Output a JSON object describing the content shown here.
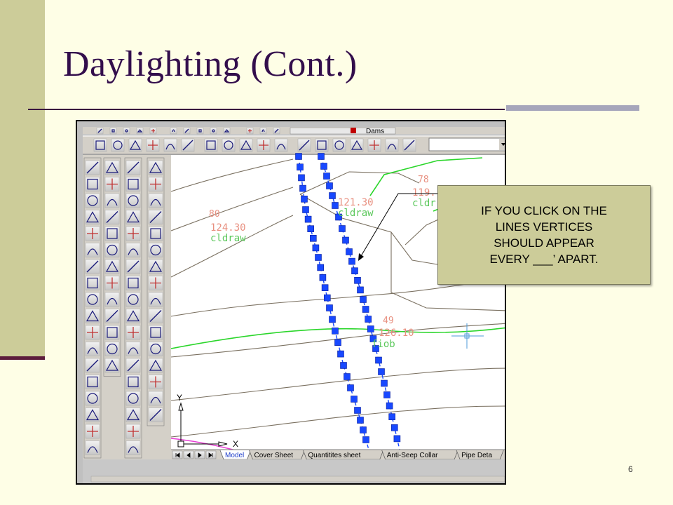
{
  "slide": {
    "title": "Daylighting (Cont.)",
    "page_number": "6",
    "callout": "IF YOU CLICK ON THE\nLINES VERTICES\nSHOULD APPEAR\nEVERY ___’ APART."
  },
  "cad": {
    "layer_name": "Dams",
    "layout_tabs": [
      "Model",
      "Cover Sheet",
      "Quantitites sheet",
      "Anti-Seep Collar",
      "Pipe Deta"
    ],
    "active_tab": "Model",
    "tab_nav": [
      "first-tab",
      "prev-tab",
      "next-tab",
      "last-tab"
    ],
    "ucs": {
      "x_label": "X",
      "y_label": "Y"
    },
    "elevation_labels": [
      {
        "top": "80",
        "value": "124.30",
        "code": "cldraw"
      },
      {
        "top": "",
        "value": "121.30",
        "code": "cldraw"
      },
      {
        "top": "78",
        "value": "119.",
        "code": "cldr"
      },
      {
        "top": "49",
        "value": "126.10",
        "code": "fiob"
      }
    ],
    "colors": {
      "canvas": "#ffffff",
      "contour": "#7a7060",
      "ground_line": "#2bd62b",
      "property_line": "#e63cd4",
      "vertex_grip": "#1848ff",
      "label_text": "#e89080",
      "label_code": "#5cc85c",
      "crosshair": "#4e9ad8"
    },
    "toolbars": {
      "standard": [
        "new-icon",
        "open-icon",
        "save-icon",
        "print-icon",
        "preview-icon",
        "cut-icon",
        "copy-icon",
        "paste-icon",
        "match-icon",
        "undo-icon",
        "redo-icon",
        "layer-icon",
        "sun-icon",
        "color-icon",
        "square-icon"
      ],
      "object_snap": [
        "dimension-linear",
        "dimension-aligned",
        "dimension-arc",
        "dimension-ordinate",
        "dimension-radius",
        "dimension-jogged",
        "dimension-diameter",
        "dimension-angular",
        "quick-dimension",
        "baseline",
        "continue",
        "quick-leader",
        "tolerance",
        "center-mark",
        "dimension-edit",
        "dimension-text-edit",
        "dimension-update",
        "dimension-style"
      ],
      "modify_col1": [
        "move-icon",
        "copy-obj-icon",
        "rotate-icon",
        "erase-icon",
        "mirror-icon",
        "array-icon",
        "stretch-icon",
        "trim-icon",
        "extend-icon",
        "break-icon",
        "chamfer-icon",
        "fillet-icon",
        "rectangle-icon",
        "rectangle2-icon",
        "join-icon",
        "scale-icon",
        "hatch-icon",
        "image-icon",
        "explode-icon"
      ],
      "modify_col2": [
        "copy2-icon",
        "edit-icon",
        "edit2-icon",
        "pen-icon",
        "offset-icon",
        "pencil-icon",
        "move2-icon",
        "list-icon",
        "measure-icon",
        "text-icon",
        "mtext-icon",
        "spell-icon",
        "field-icon"
      ],
      "draw_col1": [
        "line-icon",
        "xline-icon",
        "pline-icon",
        "polygon-icon",
        "rect-icon",
        "arc-icon",
        "circle-icon",
        "revcloud-icon",
        "spline-icon",
        "ellipse-icon",
        "ellarc-icon",
        "insert-icon",
        "block-icon",
        "point-icon",
        "hatch2-icon",
        "region-icon",
        "table-icon",
        "mtext2-icon"
      ],
      "draw_col2": [
        "erase2-icon",
        "copy3-icon",
        "mirror2-icon",
        "offset2-icon",
        "array2-icon",
        "move3-icon",
        "rotate2-icon",
        "scale2-icon",
        "stretch2-icon",
        "trim2-icon",
        "extend2-icon",
        "break2-icon",
        "join2-icon",
        "chamfer2-icon",
        "fillet2-icon",
        "explode2-icon"
      ]
    }
  }
}
